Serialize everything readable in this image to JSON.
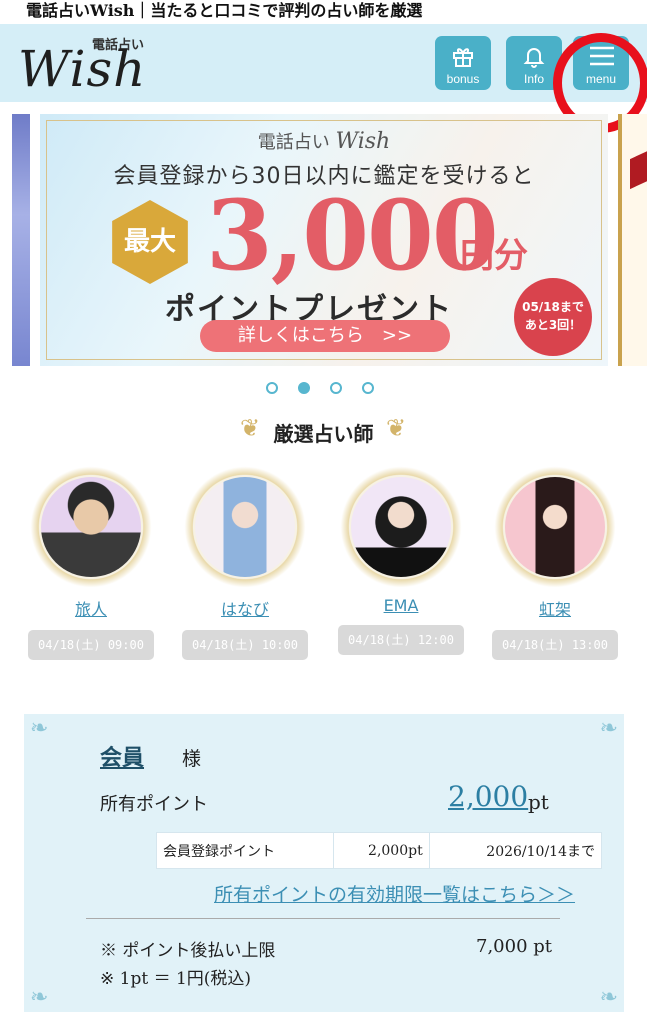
{
  "page_title": "電話占いWish｜当たると口コミで評判の占い師を厳選",
  "header": {
    "logo_small": "電話占い",
    "logo_main": "Wish",
    "buttons": [
      {
        "label": "bonus",
        "icon": "gift-icon"
      },
      {
        "label": "Info",
        "icon": "bell-icon"
      },
      {
        "label": "menu",
        "icon": "hamburger-icon"
      }
    ],
    "highlight_color": "#e8101c",
    "accent_color": "#4ab0c8"
  },
  "banner": {
    "brand_jp": "電話占い",
    "brand_en": "Wish",
    "line1": "会員登録から30日以内に鑑定を受けると",
    "badge": "最大",
    "amount": "3,000",
    "unit": "円分",
    "line2": "ポイントプレゼント",
    "cta": "詳しくはこちら　>>",
    "deadline_line1": "05/18まで",
    "deadline_line2": "あと3回！"
  },
  "carousel": {
    "count": 4,
    "active_index": 1
  },
  "section": {
    "title": "厳選占い師"
  },
  "fortune_tellers": [
    {
      "name": "旅人",
      "time": "04/18(土) 09:00"
    },
    {
      "name": "はなび",
      "time": "04/18(土) 10:00"
    },
    {
      "name": "EMA",
      "time": "04/18(土) 12:00"
    },
    {
      "name": "虹架",
      "time": "04/18(土) 13:00"
    }
  ],
  "member": {
    "name": "会員",
    "honorific": "様",
    "points_label": "所有ポイント",
    "points_value": "2,000",
    "points_unit": "pt",
    "points_table": [
      {
        "type": "会員登録ポイント",
        "amount": "2,000pt",
        "expiry": "2026/10/14まで"
      }
    ],
    "expiry_link": "所有ポイントの有効期限一覧はこちら＞＞",
    "note_deferred_label": "※ ポイント後払い上限",
    "note_deferred_value": "7,000 pt",
    "note_rate": "※ 1pt ＝ 1円(税込)"
  }
}
